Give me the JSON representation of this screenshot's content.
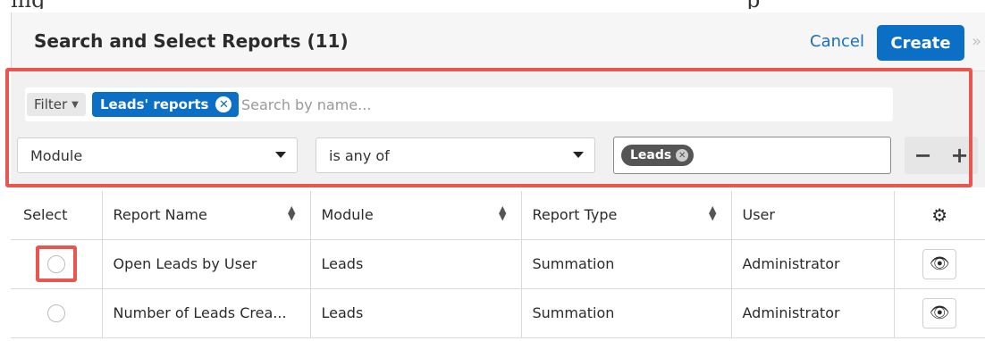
{
  "header": {
    "title": "Search and Select Reports (11)",
    "cancel_label": "Cancel",
    "create_label": "Create",
    "expand_icon": "double-chevron-right-icon"
  },
  "filter": {
    "filter_label": "Filter",
    "active_filter": "Leads' reports",
    "search_placeholder": "Search by name...",
    "field_select": "Module",
    "operator_select": "is any of",
    "value_pill": "Leads",
    "remove_label": "−",
    "add_label": "+"
  },
  "table": {
    "headers": [
      "Select",
      "Report Name",
      "Module",
      "Report Type",
      "User"
    ],
    "settings_icon": "gear-icon",
    "rows": [
      {
        "name": "Open Leads by User",
        "module": "Leads",
        "type": "Summation",
        "user": "Administrator"
      },
      {
        "name": "Number of Leads Crea...",
        "module": "Leads",
        "type": "Summation",
        "user": "Administrator"
      }
    ],
    "preview_icon": "eye-icon"
  },
  "colors": {
    "accent": "#0b6fc6",
    "highlight": "#e8564f"
  }
}
